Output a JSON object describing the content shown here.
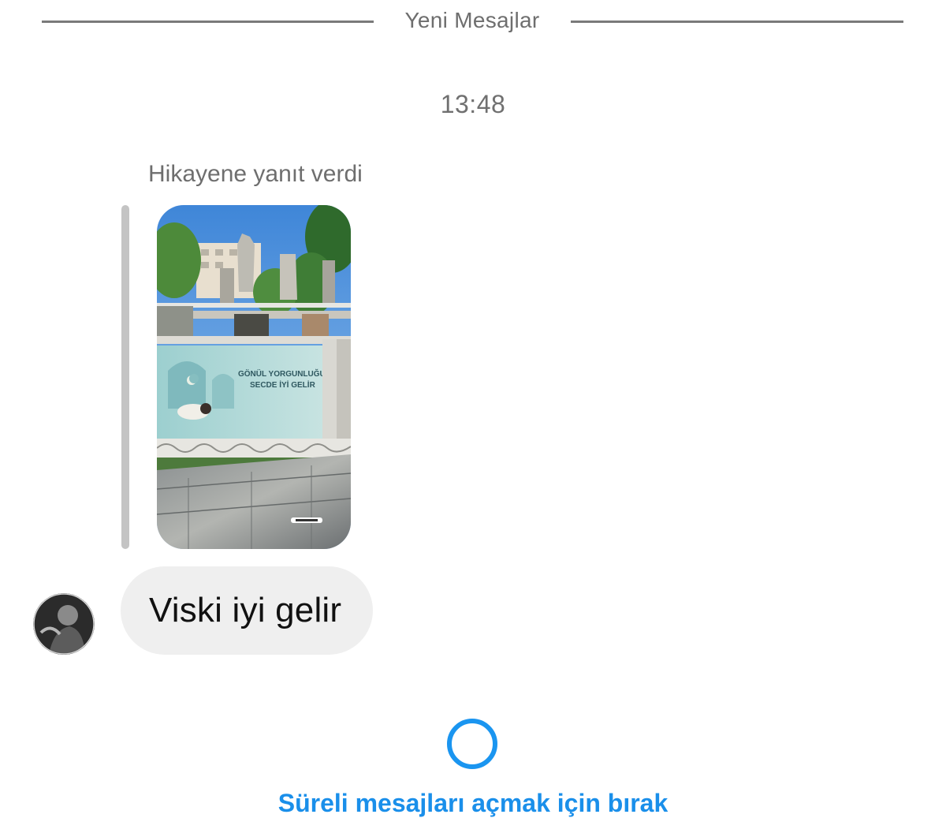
{
  "divider": {
    "label": "Yeni Mesajlar"
  },
  "thread": {
    "timestamp": "13:48",
    "story_reply_caption": "Hikayene yanıt verdi",
    "story_thumbnail": {
      "banner_text_line1": "GÖNÜL YORGUNLUĞUNA",
      "banner_text_line2": "SECDE İYİ GELİR"
    },
    "message": {
      "text": "Viski iyi gelir"
    }
  },
  "footer": {
    "vanish_mode_label": "Süreli mesajları açmak için bırak"
  },
  "colors": {
    "accent_blue": "#1a95f0",
    "bubble_gray": "#efefef",
    "secondary_text": "#6e6e6e"
  }
}
